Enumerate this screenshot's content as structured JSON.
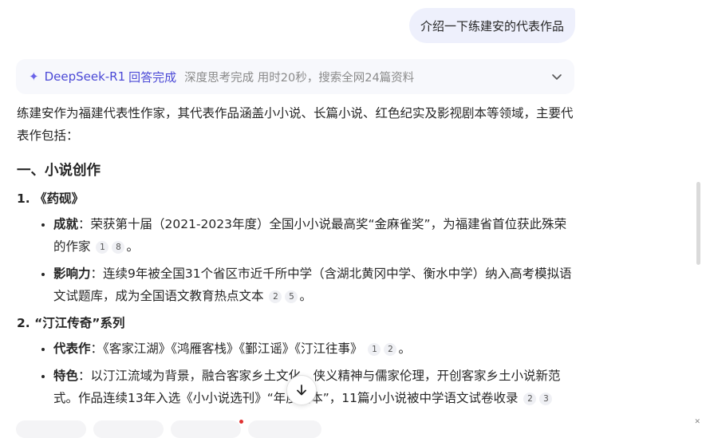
{
  "user_message": "介绍一下练建安的代表作品",
  "reasoning": {
    "model": "DeepSeek-R1",
    "status": "回答完成",
    "meta": "深度思考完成 用时20秒，搜索全网24篇资料"
  },
  "answer": {
    "intro": "练建安作为福建代表性作家，其代表作品涵盖小小说、长篇小说、红色纪实及影视剧本等领域，主要代表作包括：",
    "section1_title": "一、小说创作",
    "items": [
      {
        "title": "1. 《药砚》",
        "bullets": [
          {
            "label": "成就",
            "text": "：荣获第十届（2021-2023年度）全国小小说最高奖“金麻雀奖”，为福建省首位获此殊荣的作家",
            "cites": [
              "1",
              "8"
            ],
            "end": "。"
          },
          {
            "label": "影响力",
            "text": "：连续9年被全国31个省区市近千所中学（含湖北黄冈中学、衡水中学）纳入高考模拟语文试题库，成为全国语文教育热点文本",
            "cites": [
              "2",
              "5"
            ],
            "end": "。"
          }
        ]
      },
      {
        "title": "2. “汀江传奇”系列",
        "bullets": [
          {
            "label": "代表作",
            "text": "：《客家江湖》《鸿雁客栈》《鄞江谣》《汀江往事》",
            "cites": [
              "1",
              "2"
            ],
            "end": "。"
          },
          {
            "label": "特色",
            "text": "：以汀江流域为背景，融合客家乡土文化、侠义精神与儒家伦理，开创客家乡土小说新范式。作品连续13年入选《小小说选刊》“年度选本”，11篇小小说被中学语文试卷收录",
            "cites": [
              "2",
              "3"
            ],
            "end": ""
          }
        ]
      }
    ]
  }
}
